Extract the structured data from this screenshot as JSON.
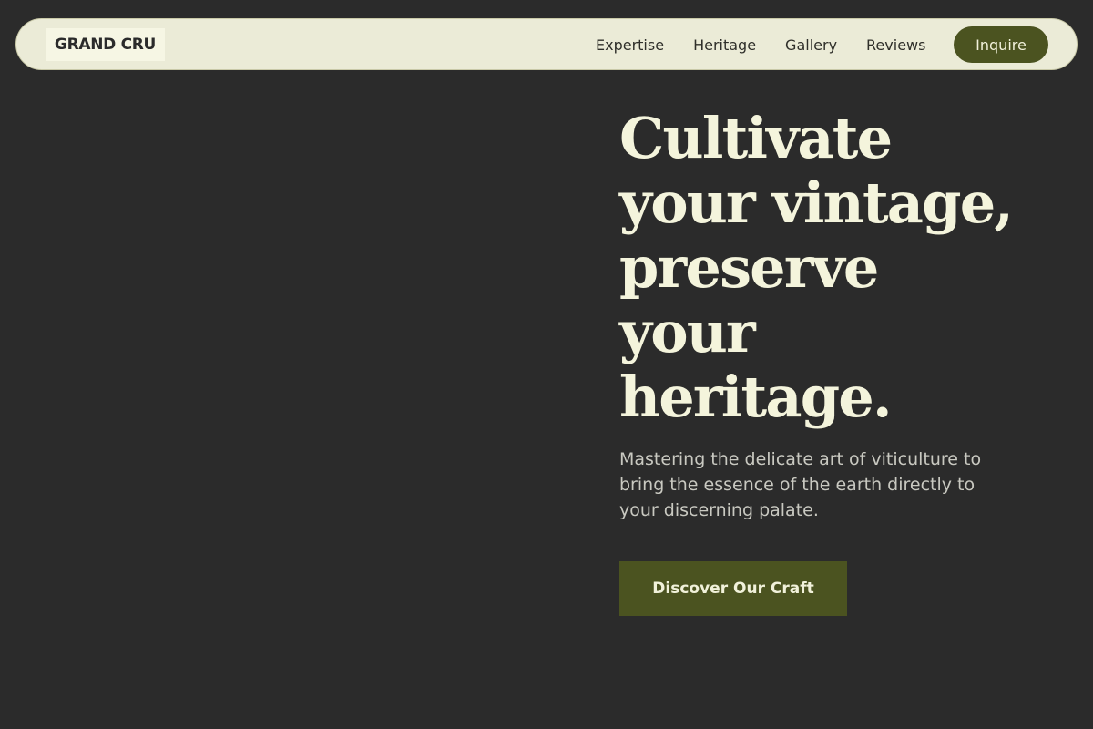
{
  "header": {
    "logo": "GRAND CRU",
    "nav": [
      {
        "label": "Expertise"
      },
      {
        "label": "Heritage"
      },
      {
        "label": "Gallery"
      },
      {
        "label": "Reviews"
      }
    ],
    "cta_label": "Inquire"
  },
  "hero": {
    "title": "Cultivate\nyour vintage,\npreserve\nyour\nheritage.",
    "subtitle": "Mastering the delicate art of viticulture to bring the essence of the earth directly to your discerning palate.",
    "cta_label": "Discover Our Craft"
  },
  "colors": {
    "background": "#2b2b2b",
    "nav_background": "#ebebd7",
    "accent": "#4b5320",
    "hero_text": "#f4f4dc"
  }
}
